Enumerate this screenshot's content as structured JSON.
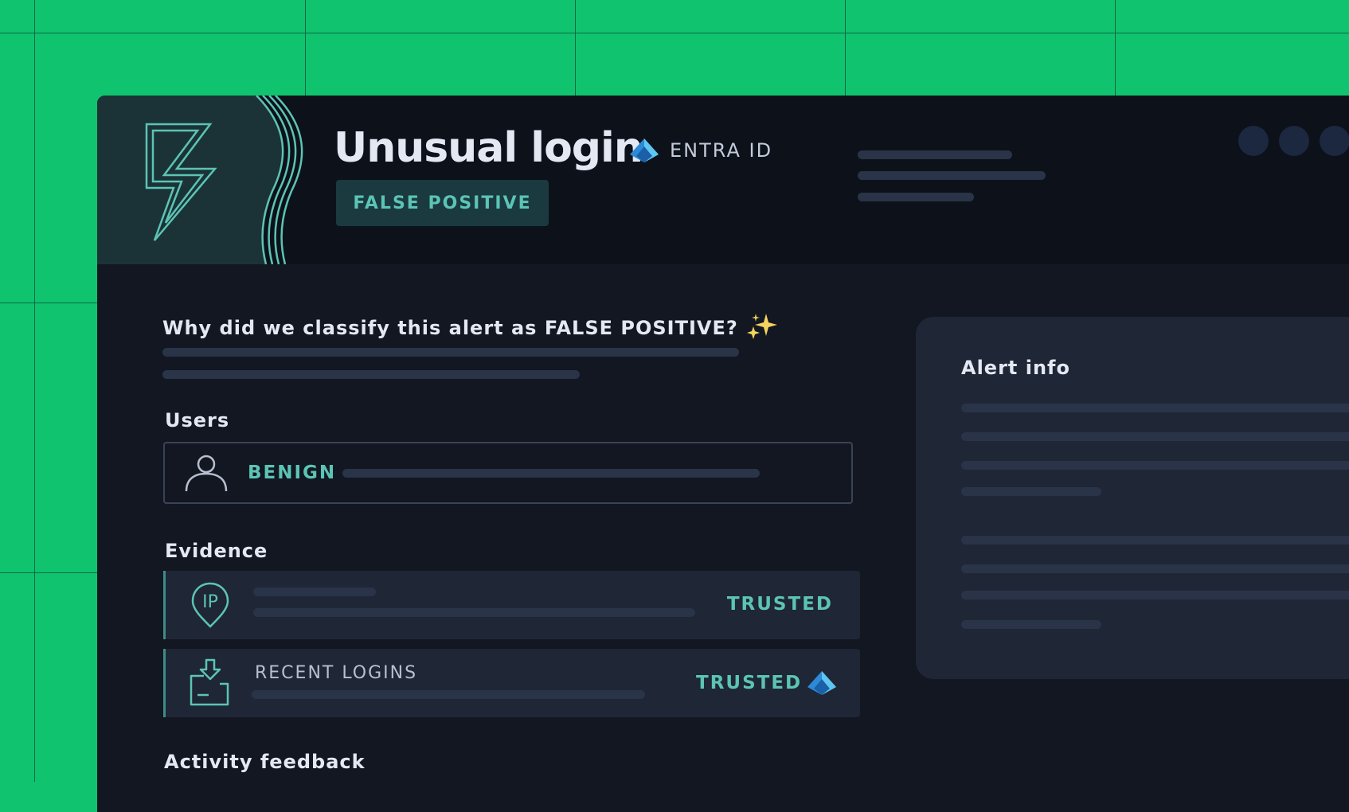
{
  "colors": {
    "background": "#10c36e",
    "window": "#121722",
    "header": "#0d111a",
    "accent_teal": "#5cc4b5",
    "card": "#1f2636",
    "placeholder": "#2a3448"
  },
  "alert": {
    "title": "Unusual login",
    "source": {
      "icon": "entra-id-icon",
      "label": "ENTRA ID"
    },
    "classification": "FALSE POSITIVE"
  },
  "explanation": {
    "question": "Why did we classify this alert as FALSE POSITIVE?",
    "question_icon": "sparkles-icon"
  },
  "users": {
    "heading": "Users",
    "icon": "user-icon",
    "status": "BENIGN"
  },
  "evidence": {
    "heading": "Evidence",
    "items": [
      {
        "icon": "ip-location-icon",
        "title": "",
        "status": "TRUSTED"
      },
      {
        "icon": "download-tray-icon",
        "title": "RECENT LOGINS",
        "status": "TRUSTED",
        "source_icon": "entra-id-icon"
      }
    ]
  },
  "activity": {
    "heading": "Activity feedback"
  },
  "alert_info": {
    "heading": "Alert info"
  }
}
